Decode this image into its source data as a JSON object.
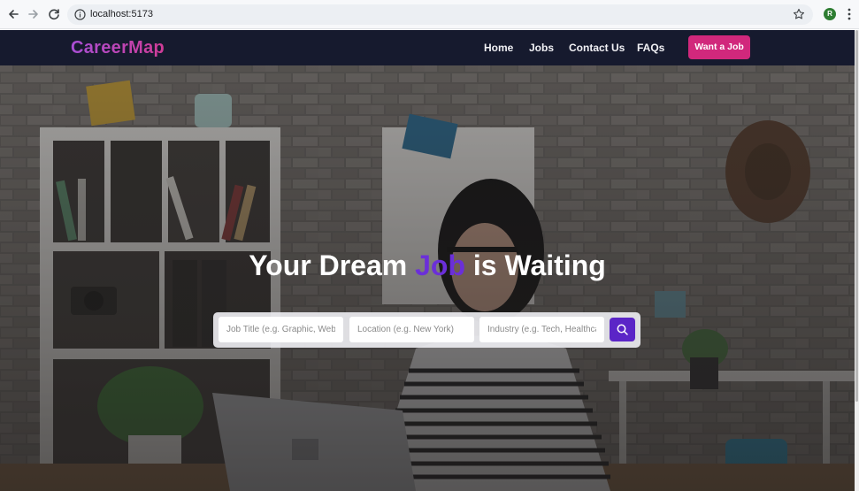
{
  "browser": {
    "url": "localhost:5173",
    "profile_initial": "R",
    "icons": [
      "back-arrow-icon",
      "forward-arrow-icon",
      "reload-icon",
      "site-info-icon",
      "bookmark-star-icon",
      "kebab-menu-icon"
    ]
  },
  "site": {
    "logo": "CareerMap",
    "nav": {
      "home": "Home",
      "jobs": "Jobs",
      "contact": "Contact Us",
      "faqs": "FAQs"
    },
    "cta_label": "Want a Job"
  },
  "hero": {
    "headline_before": "Your Dream ",
    "headline_accent": "Job",
    "headline_after": " is Waiting",
    "search": {
      "job_title_placeholder": "Job Title (e.g. Graphic, Web",
      "location_placeholder": "Location (e.g. New York)",
      "industry_placeholder": "Industry (e.g. Tech, Healthca",
      "button_icon": "search-icon"
    }
  },
  "colors": {
    "header_bg": "#161a2e",
    "logo_gradient": [
      "#a94fd6",
      "#d03c97"
    ],
    "cta_bg": "#d1287c",
    "accent_purple": "#6b2fd9",
    "search_button_bg": "#5b25c7"
  }
}
